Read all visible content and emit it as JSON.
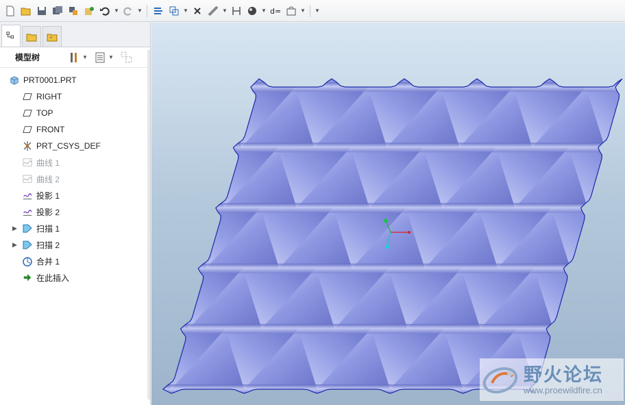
{
  "toolbar": {
    "buttons": [
      "new-file-icon",
      "open-file-icon",
      "save-icon",
      "save-copy-icon",
      "backup-icon",
      "regenerate-icon",
      "undo-icon",
      "redo-icon",
      "switch-window-icon",
      "orient-icon",
      "close-icon",
      "measure-icon",
      "datum-display-icon",
      "shading-icon",
      "dimension-icon",
      "view-manager-icon",
      "customize-icon"
    ]
  },
  "model_tree": {
    "title": "模型树",
    "items": [
      {
        "label": "PRT0001.PRT",
        "icon": "part-icon",
        "level": 0,
        "dim": false,
        "expandable": false
      },
      {
        "label": "RIGHT",
        "icon": "datum-plane-icon",
        "level": 1,
        "dim": false,
        "expandable": false
      },
      {
        "label": "TOP",
        "icon": "datum-plane-icon",
        "level": 1,
        "dim": false,
        "expandable": false
      },
      {
        "label": "FRONT",
        "icon": "datum-plane-icon",
        "level": 1,
        "dim": false,
        "expandable": false
      },
      {
        "label": "PRT_CSYS_DEF",
        "icon": "csys-icon",
        "level": 1,
        "dim": false,
        "expandable": false
      },
      {
        "label": "曲线 1",
        "icon": "curve-icon",
        "level": 1,
        "dim": true,
        "expandable": false
      },
      {
        "label": "曲线 2",
        "icon": "curve-icon",
        "level": 1,
        "dim": true,
        "expandable": false
      },
      {
        "label": "投影 1",
        "icon": "projection-icon",
        "level": 1,
        "dim": false,
        "expandable": false
      },
      {
        "label": "投影 2",
        "icon": "projection-icon",
        "level": 1,
        "dim": false,
        "expandable": false
      },
      {
        "label": "扫描 1",
        "icon": "sweep-icon",
        "level": 1,
        "dim": false,
        "expandable": true
      },
      {
        "label": "扫描 2",
        "icon": "sweep-icon",
        "level": 1,
        "dim": false,
        "expandable": true
      },
      {
        "label": "合并 1",
        "icon": "merge-icon",
        "level": 1,
        "dim": false,
        "expandable": false
      },
      {
        "label": "在此插入",
        "icon": "insert-here-icon",
        "level": 1,
        "dim": false,
        "expandable": false
      }
    ]
  },
  "watermark": {
    "name": "野火论坛",
    "url": "www.proewildfire.cn"
  },
  "colors": {
    "surface": "#8b95e0",
    "surface_dark": "#5e68c0",
    "surface_light": "#c4caf4",
    "edge": "#1b2aa8"
  }
}
